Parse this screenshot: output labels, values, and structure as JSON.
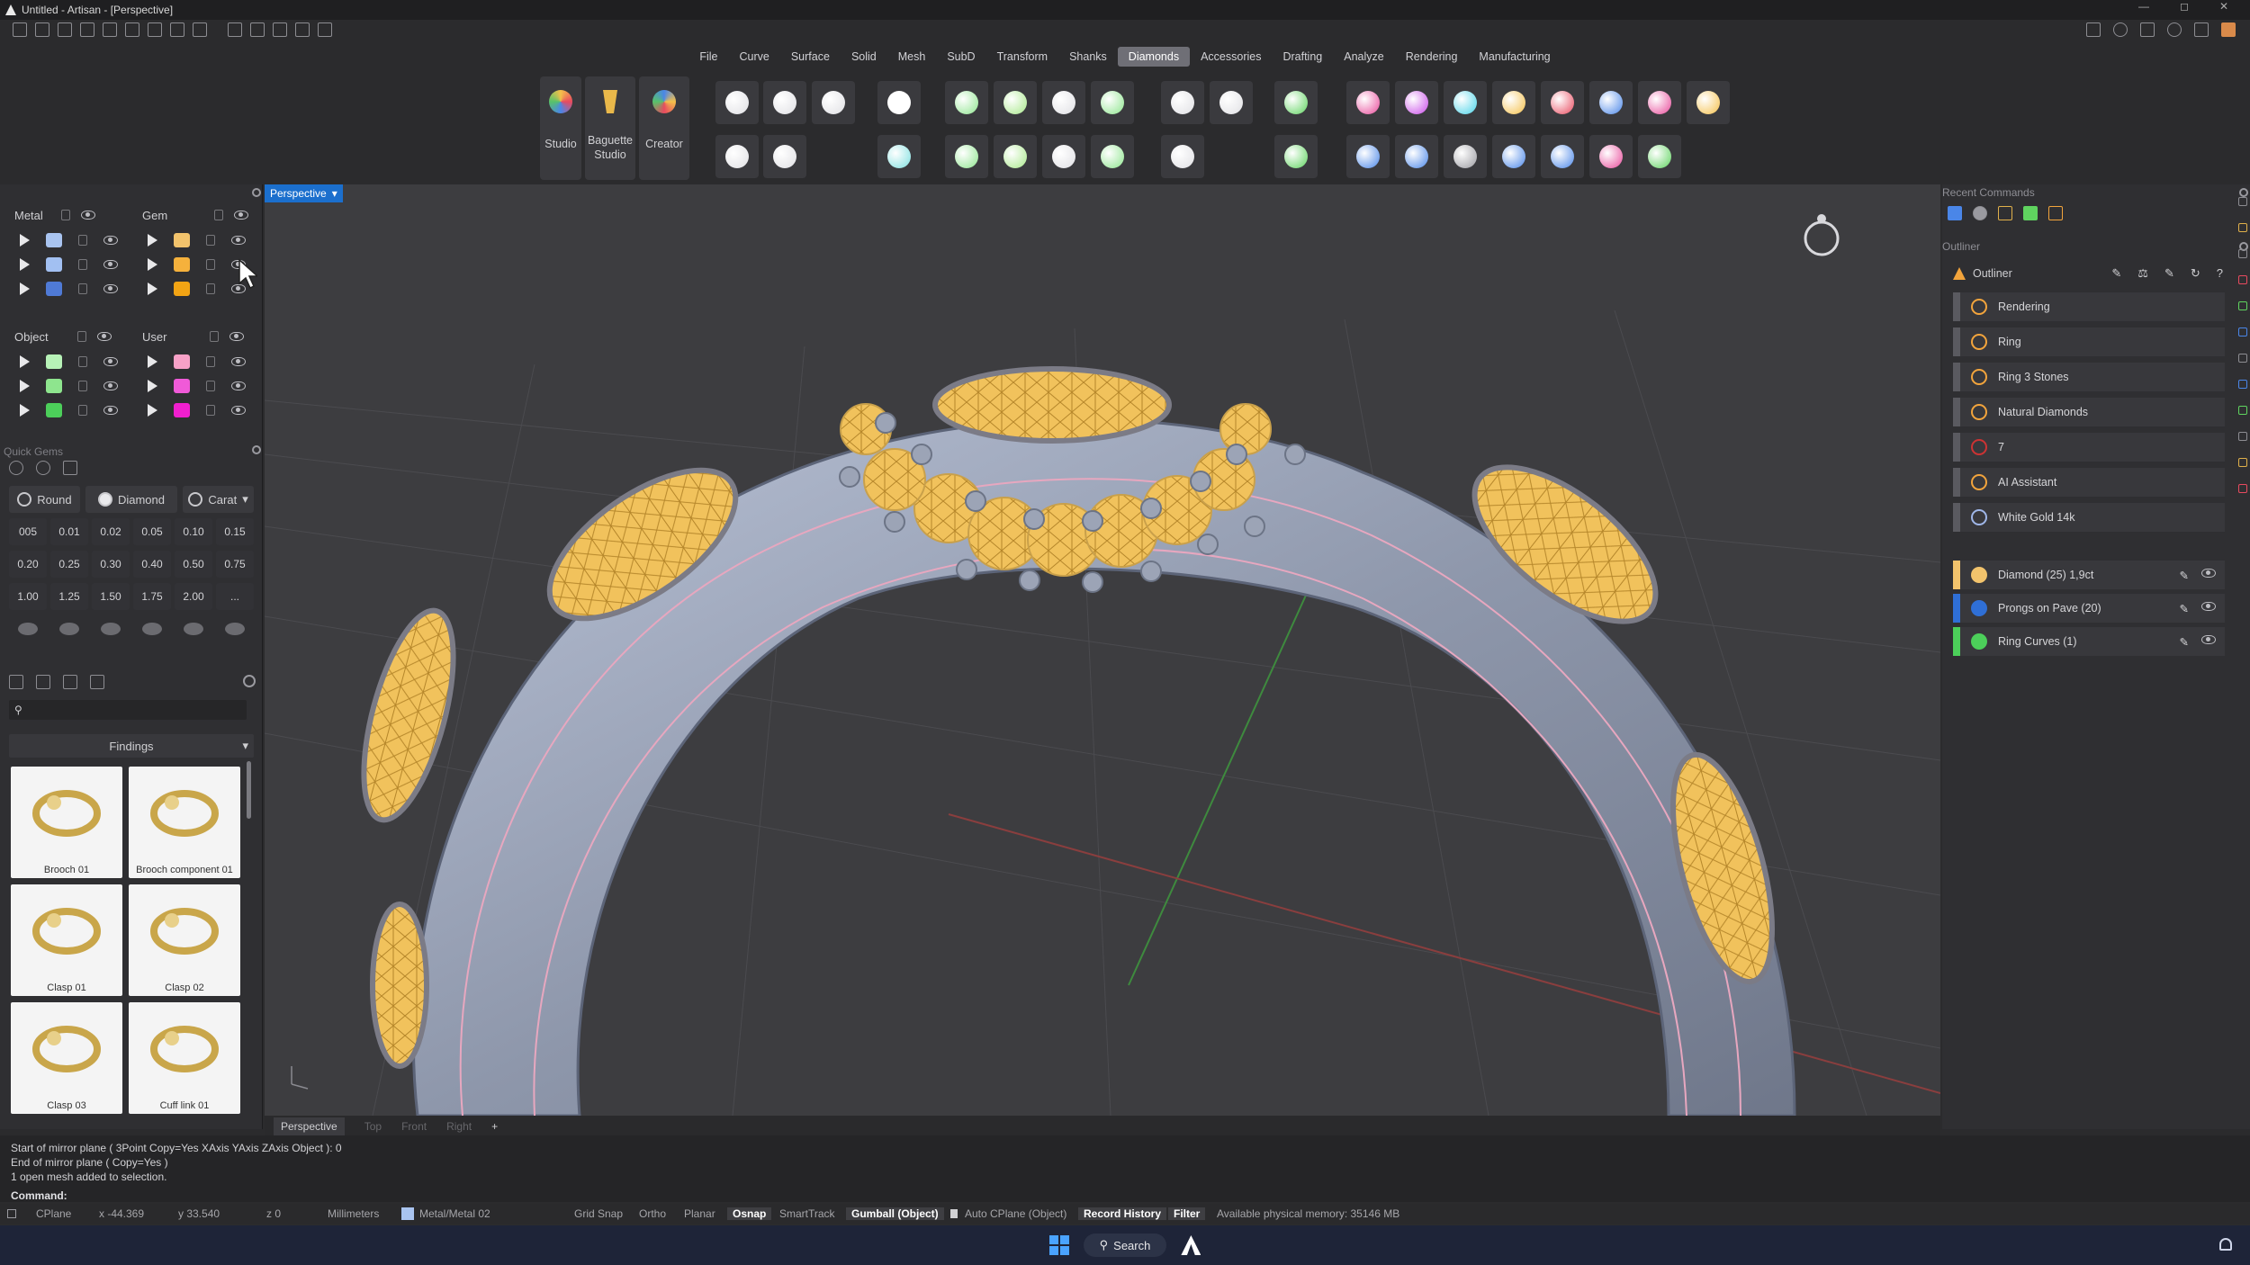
{
  "window": {
    "title": "Untitled - Artisan - [Perspective]"
  },
  "menu": [
    "File",
    "Curve",
    "Surface",
    "Solid",
    "Mesh",
    "SubD",
    "Transform",
    "Shanks",
    "Diamonds",
    "Accessories",
    "Drafting",
    "Analyze",
    "Rendering",
    "Manufacturing"
  ],
  "active_menu": "Diamonds",
  "ribbon": {
    "studio": "Studio",
    "baguette_l1": "Baguette",
    "baguette_l2": "Studio",
    "creator": "Creator"
  },
  "layers": {
    "metal": {
      "title": "Metal",
      "colors": [
        "#a9c4f0",
        "#a2c0f2",
        "#4f7ad6"
      ]
    },
    "gem": {
      "title": "Gem",
      "colors": [
        "#f2c36c",
        "#f5b13c",
        "#f2a414"
      ]
    },
    "object": {
      "title": "Object",
      "colors": [
        "#b7f2b7",
        "#8ee58e",
        "#4ccf5a"
      ]
    },
    "user": {
      "title": "User",
      "colors": [
        "#f7a1c7",
        "#f05ad8",
        "#f01fcf"
      ]
    }
  },
  "quick_gems": {
    "title": "Quick Gems",
    "shape": "Round",
    "material": "Diamond",
    "unit": "Carat",
    "values": [
      "005",
      "0.01",
      "0.02",
      "0.05",
      "0.10",
      "0.15",
      "0.20",
      "0.25",
      "0.30",
      "0.40",
      "0.50",
      "0.75",
      "1.00",
      "1.25",
      "1.50",
      "1.75",
      "2.00",
      "..."
    ]
  },
  "library": {
    "category": "Findings",
    "search_placeholder": "",
    "items": [
      "Brooch 01",
      "Brooch component 01",
      "Clasp 01",
      "Clasp 02",
      "Clasp 03",
      "Cuff link 01"
    ]
  },
  "viewport": {
    "active": "Perspective",
    "tabs": [
      "Perspective",
      "Top",
      "Front",
      "Right"
    ]
  },
  "recent_commands_title": "Recent Commands",
  "outliner": {
    "panel_title": "Outliner",
    "header": "Outliner",
    "items": [
      {
        "label": "Rendering",
        "color": "#f2a43c"
      },
      {
        "label": "Ring",
        "color": "#f2a43c"
      },
      {
        "label": "Ring 3 Stones",
        "color": "#f2a43c"
      },
      {
        "label": "Natural Diamonds",
        "color": "#f2a43c"
      },
      {
        "label": "7",
        "color": "#c33"
      },
      {
        "label": "AI Assistant",
        "color": "#f2a43c"
      },
      {
        "label": "White Gold 14k",
        "color": "#9fb6e8"
      }
    ],
    "layers": [
      {
        "label": "Diamond (25) 1,9ct",
        "color": "#f2c36c"
      },
      {
        "label": "Prongs on Pave (20)",
        "color": "#2f6fd6"
      },
      {
        "label": "Ring Curves (1)",
        "color": "#4ccf5a"
      }
    ]
  },
  "command_history": [
    "Start of mirror plane ( 3Point  Copy=Yes  XAxis  YAxis  ZAxis  Object ): 0",
    "End of mirror plane ( Copy=Yes )",
    "1 open mesh added to selection."
  ],
  "command_prompt": "Command:",
  "status": {
    "cplane": "CPlane",
    "x": "x -44.369",
    "y": "y 33.540",
    "z": "z 0",
    "units": "Millimeters",
    "layer": "Metal/Metal 02",
    "grid_snap": "Grid Snap",
    "ortho": "Ortho",
    "planar": "Planar",
    "osnap": "Osnap",
    "smarttrack": "SmartTrack",
    "gumball": "Gumball (Object)",
    "auto_cplane": "Auto CPlane (Object)",
    "record_history": "Record History",
    "filter": "Filter",
    "memory": "Available physical memory: 35146 MB"
  },
  "taskbar": {
    "search": "Search"
  }
}
